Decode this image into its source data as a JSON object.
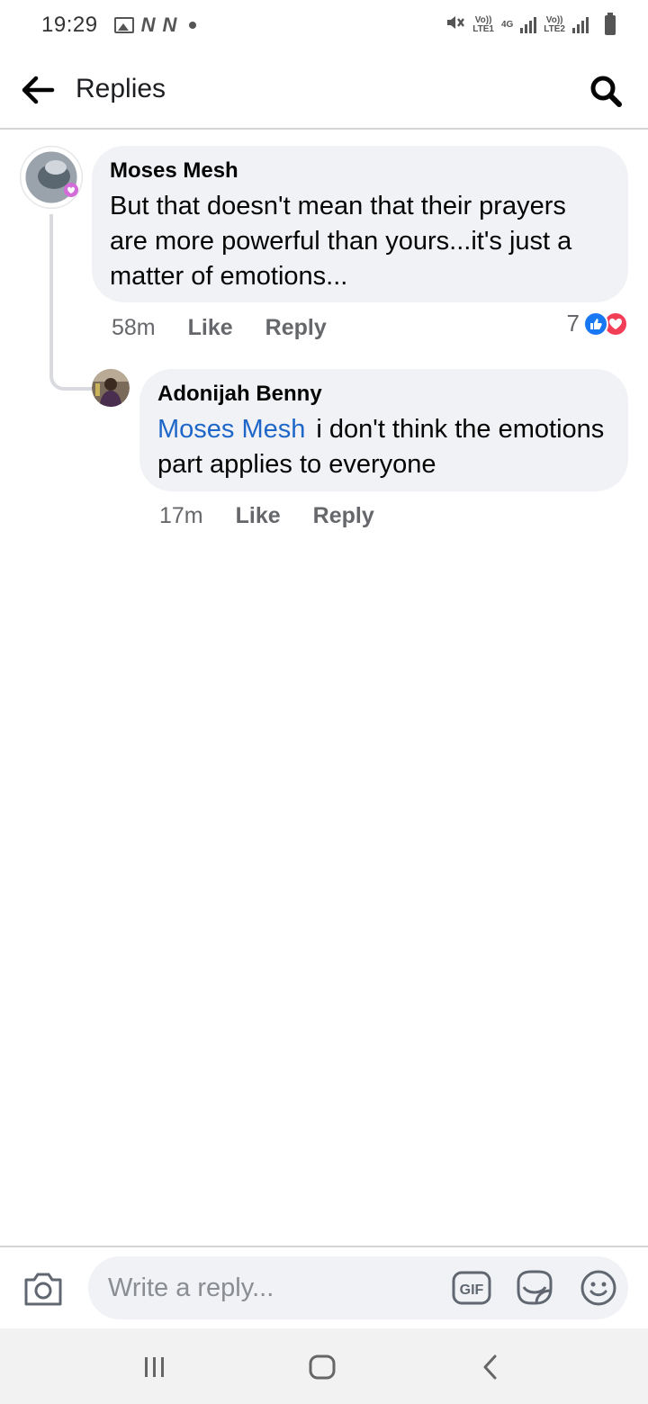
{
  "status_bar": {
    "time": "19:29",
    "sim1_label": "Vo))\nLTE1",
    "network_label": "4G",
    "sim2_label": "Vo))\nLTE2",
    "notif_letter_1": "N",
    "notif_letter_2": "N"
  },
  "header": {
    "title": "Replies",
    "back_icon": "arrow-left-icon",
    "search_icon": "search-icon"
  },
  "comments": [
    {
      "author": "Moses Mesh",
      "text": "But that doesn't mean that their prayers are more powerful than yours...it's just a matter of emotions...",
      "time": "58m",
      "like_label": "Like",
      "reply_label": "Reply",
      "reaction_count": "7",
      "reactions": [
        "like-reaction-icon",
        "love-reaction-icon"
      ]
    },
    {
      "author": "Adonijah Benny",
      "mention": "Moses Mesh",
      "text": "i don't think the emotions part  applies to everyone",
      "time": "17m",
      "like_label": "Like",
      "reply_label": "Reply"
    }
  ],
  "composer": {
    "placeholder": "Write a reply...",
    "gif_label": "GIF",
    "icons": [
      "camera-icon",
      "gif-icon",
      "sticker-icon",
      "emoji-icon"
    ]
  },
  "colors": {
    "bubble_bg": "#f0f2f5",
    "mention_blue": "#1f66c9",
    "like_blue": "#1877f2",
    "love_red": "#f33e58",
    "meta_gray": "#65676b"
  }
}
